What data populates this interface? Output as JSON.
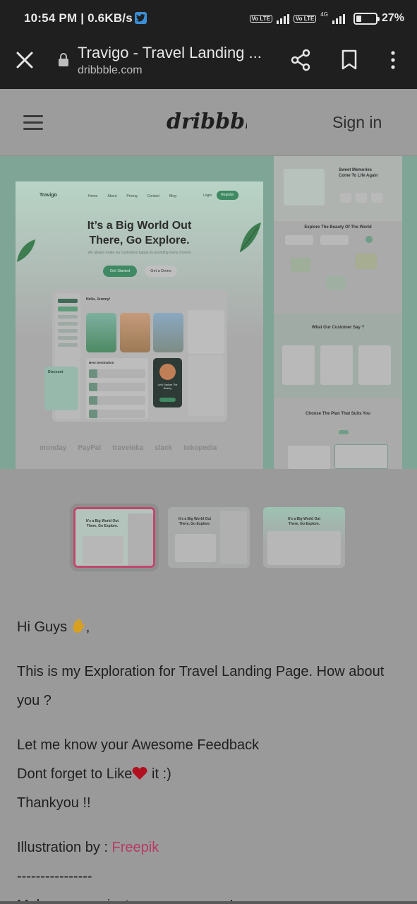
{
  "status_bar": {
    "time_speed": "10:54 PM | 0.6KB/s",
    "volte_1": "Vo LTE",
    "volte_2": "Vo LTE",
    "network_type": "4G",
    "battery": "27%",
    "battery_level": 0.27
  },
  "browser": {
    "title": "Travigo - Travel Landing ...",
    "domain": "dribbble.com"
  },
  "site_header": {
    "logo": "dribbble",
    "sign_in": "Sign in"
  },
  "shot": {
    "brand": "Travigo",
    "nav": [
      "Home",
      "About",
      "Pricing",
      "Contact",
      "Blog"
    ],
    "login": "Login",
    "register": "Register",
    "hero_title_1": "It’s a Big World Out",
    "hero_title_2": "There, Go Explore.",
    "hero_sub": "We always make our customers happy by providing many choices",
    "get_started": "Get Started",
    "get_demo": "Get a Demo",
    "greeting": "Hello, Jeremy!",
    "best_destination": "Best Destination",
    "discount": "Discount",
    "explore_promo": "Let's Explore The Beauty",
    "brands": [
      "monday",
      "PayPal",
      "traveloka",
      "slack",
      "tokopedia"
    ],
    "right_sections": [
      "Sweet Memories Come To Life Again",
      "Explore The Beauty Of The World",
      "What Our Customer Say ?",
      "Choose The Plan That Suits You"
    ]
  },
  "description": {
    "greeting": "Hi Guys",
    "greeting_suffix": ",",
    "line1": "This is my Exploration for Travel Landing Page. How about you ?",
    "line2": "Let me know your Awesome Feedback",
    "line3_pre": "Dont forget to Like",
    "line3_post": " it :)",
    "line4": "Thankyou !!",
    "illustration_label": "Illustration by : ",
    "illustration_link": "Freepik",
    "separator": "----------------",
    "line5": "Make your project more awesome!"
  },
  "colors": {
    "accent_pink": "#b83a66",
    "brand_green": "#3f8a63"
  }
}
